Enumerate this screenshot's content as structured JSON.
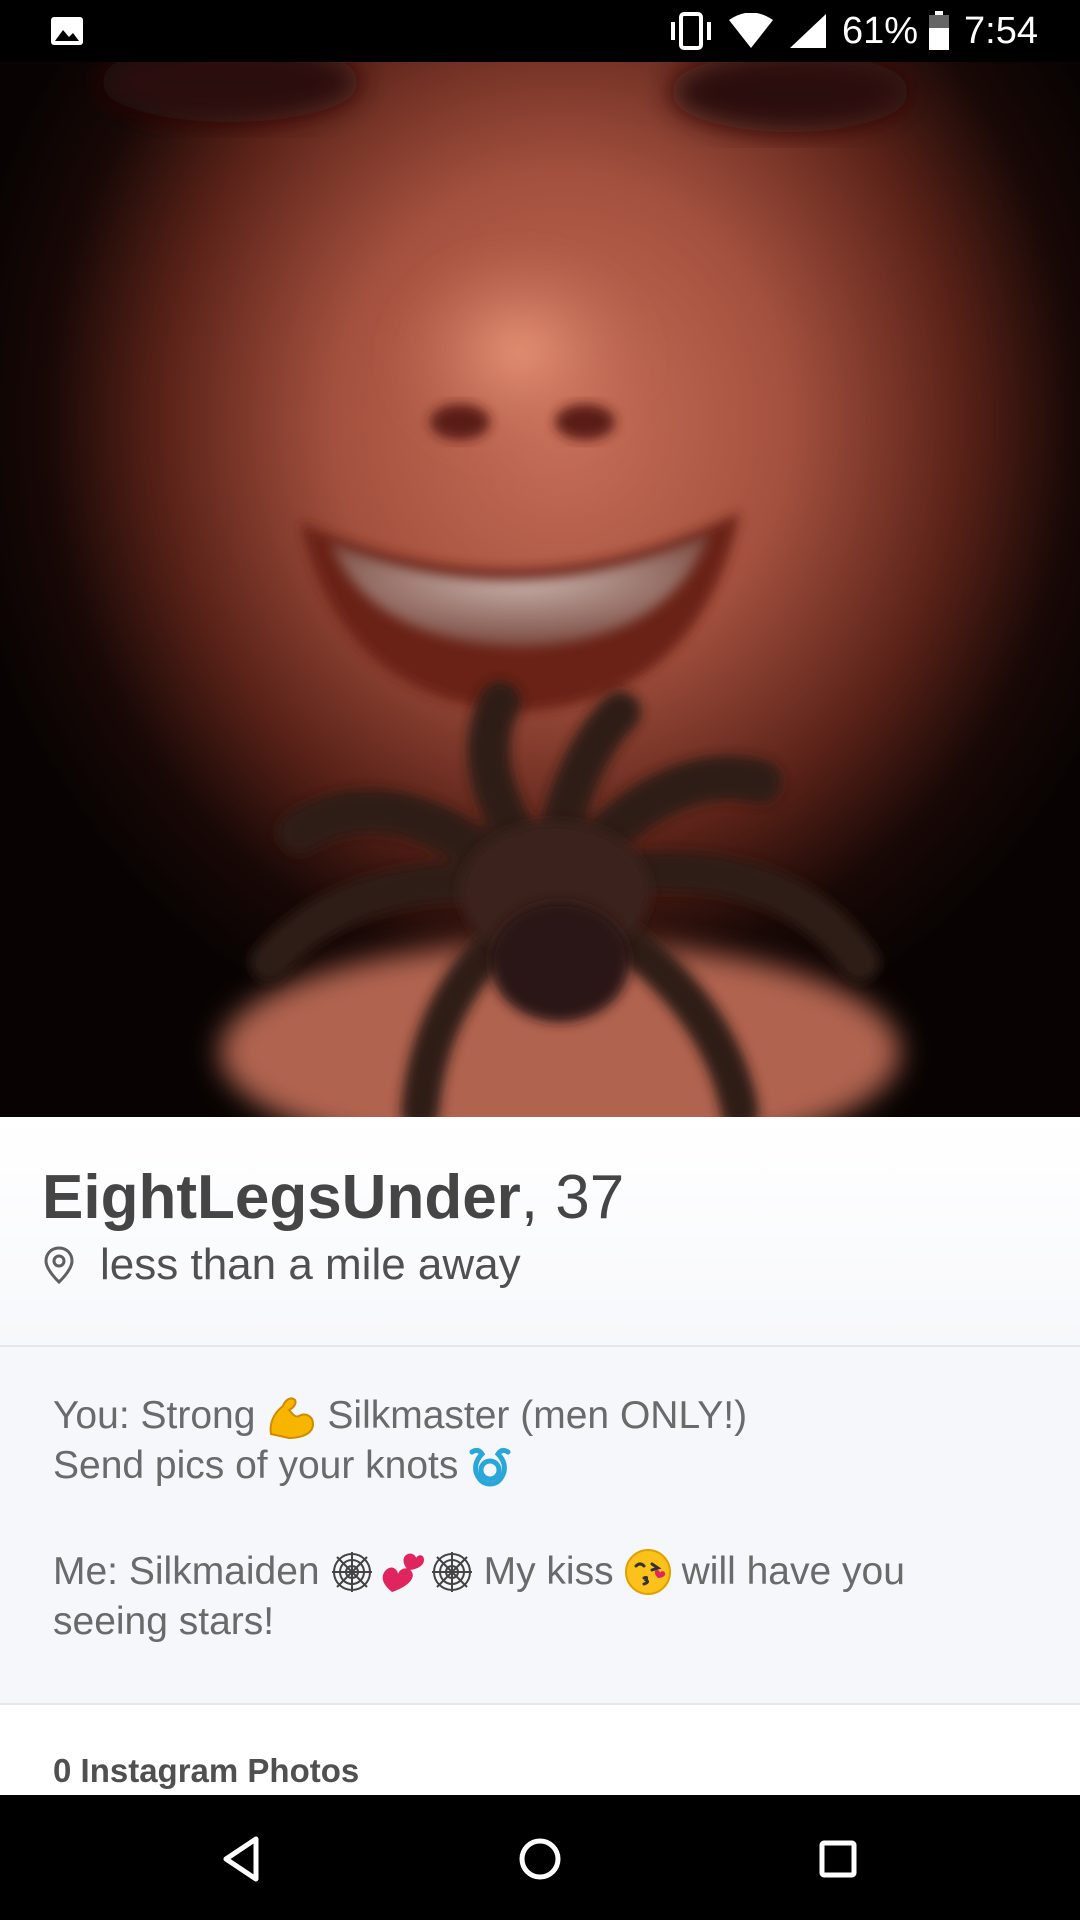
{
  "status_bar": {
    "battery_percent": "61%",
    "time": "7:54",
    "icons": [
      "gallery-icon",
      "vibrate-icon",
      "wifi-icon",
      "cell-signal-icon",
      "battery-icon"
    ]
  },
  "photo": {
    "subject": "profile-photo"
  },
  "profile": {
    "name": "EightLegsUnder",
    "separator": ",",
    "age": "37",
    "distance": "less than a mile away",
    "distance_icon": "location-pin-icon"
  },
  "bio": {
    "line1_a": "You: Strong",
    "line1_b": "Silkmaster (men ONLY!)",
    "line2": "Send pics of your knots",
    "line3_a": "Me: Silkmaiden",
    "line3_b": "My kiss",
    "line3_c": "will have you",
    "line4": "seeing stars!",
    "emojis": [
      "flexed-biceps-emoji",
      "curly-loop-emoji",
      "spider-web-emoji",
      "heart-emoji",
      "spider-web-emoji",
      "kissing-face-emoji"
    ]
  },
  "instagram": {
    "label": "0 Instagram Photos"
  },
  "nav_bar": {
    "buttons": [
      "back-icon",
      "home-icon",
      "recents-icon"
    ]
  },
  "colors": {
    "status_bar_bg": "#000000",
    "text_dark": "#454545",
    "text_muted": "#6a6a6a",
    "divider": "#e6e7ec",
    "section_bg": "#f6f7fa"
  }
}
